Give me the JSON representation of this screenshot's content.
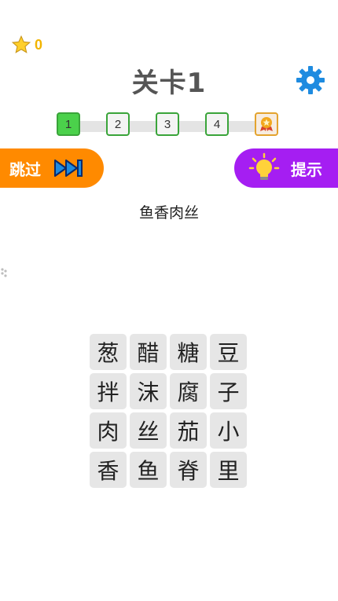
{
  "stars": {
    "count": "0"
  },
  "header": {
    "title": "关卡1"
  },
  "progress": {
    "steps": [
      "1",
      "2",
      "3",
      "4"
    ],
    "active_step": 1
  },
  "buttons": {
    "skip_label": "跳过",
    "hint_label": "提示"
  },
  "puzzle": {
    "target_answer": "鱼香肉丝",
    "tiles": [
      [
        "葱",
        "醋",
        "糖",
        "豆"
      ],
      [
        "拌",
        "沫",
        "腐",
        "子"
      ],
      [
        "肉",
        "丝",
        "茄",
        "小"
      ],
      [
        "香",
        "鱼",
        "脊",
        "里"
      ]
    ]
  },
  "colors": {
    "skip": "#ff8a00",
    "hint": "#a51ef2",
    "gear": "#1e8be0",
    "active_step": "#4bd14b"
  }
}
